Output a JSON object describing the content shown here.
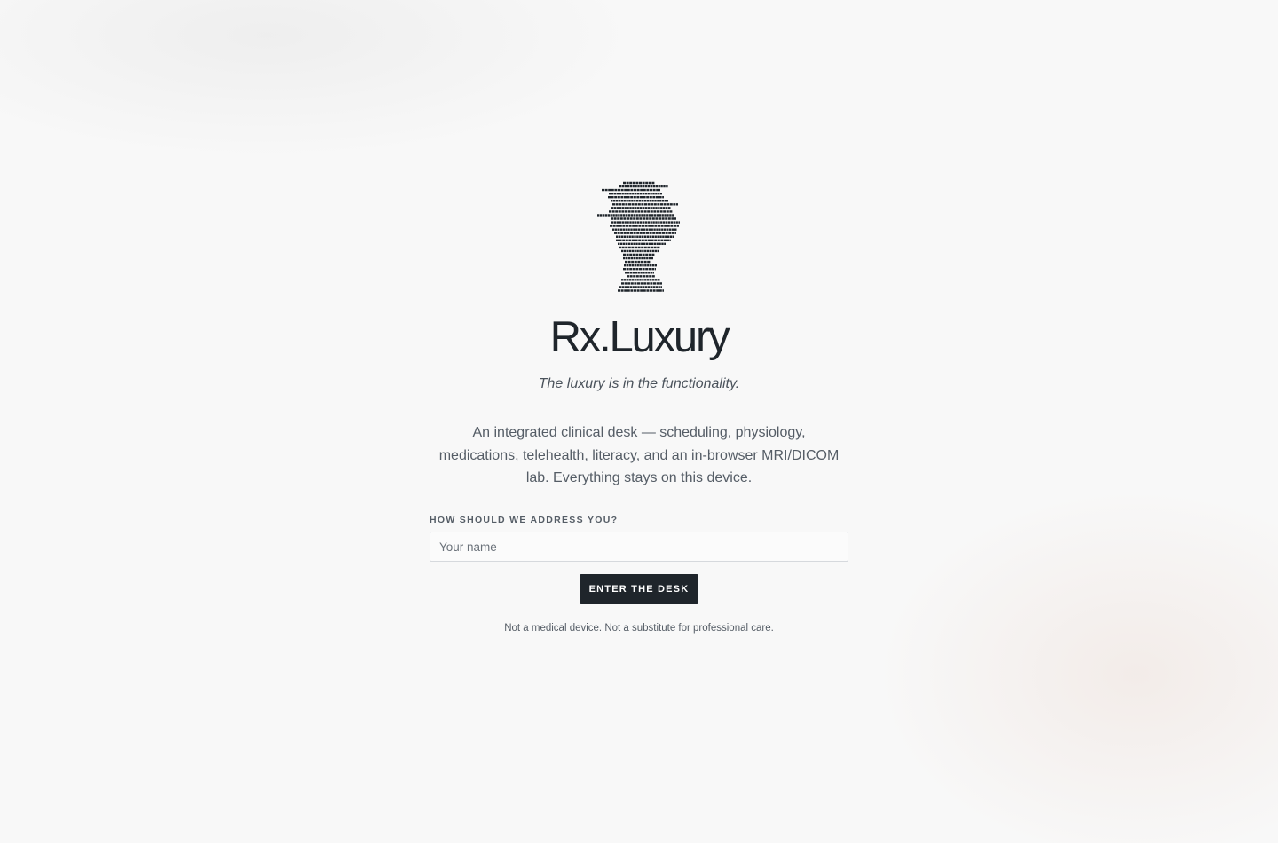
{
  "app": {
    "brand": "Rx.Luxury",
    "tagline": "The luxury is in the functionality.",
    "logo_icon": "ascii-head-bust-icon"
  },
  "intro": {
    "description": "An integrated clinical desk — scheduling, physiology, medications, telehealth, literacy, and an in-browser MRI/DICOM lab. Everything stays on this device."
  },
  "form": {
    "name_label": "HOW SHOULD WE ADDRESS YOU?",
    "name_placeholder": "Your name",
    "name_value": "",
    "submit_label": "ENTER THE DESK"
  },
  "footer": {
    "disclaimer": "Not a medical device. Not a substitute for professional care."
  },
  "colors": {
    "text": "#1f252b",
    "muted": "#555d66",
    "button_bg": "#1f252b",
    "button_text": "#ffffff",
    "background": "#f8f8f8"
  }
}
